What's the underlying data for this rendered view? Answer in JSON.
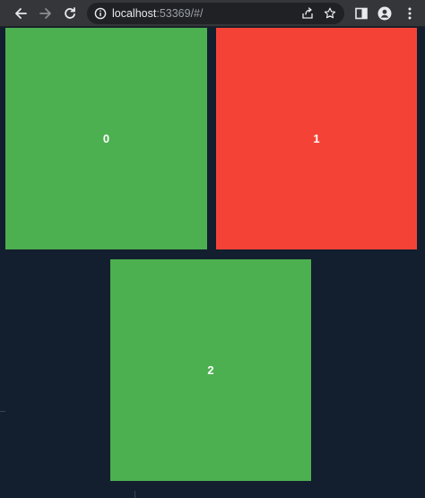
{
  "browser": {
    "url_host": "localhost",
    "url_rest": ":53369/#/",
    "icons": [
      "back-arrow-icon",
      "forward-arrow-icon",
      "reload-icon",
      "site-info-icon",
      "share-icon",
      "bookmark-star-icon",
      "side-panel-icon",
      "profile-icon",
      "menu-icon"
    ]
  },
  "colors": {
    "background": "#131f2e",
    "green": "#4caf50",
    "red": "#f44336"
  },
  "boxes": [
    {
      "label": "0",
      "color": "#4caf50"
    },
    {
      "label": "1",
      "color": "#f44336"
    },
    {
      "label": "2",
      "color": "#4caf50"
    }
  ]
}
